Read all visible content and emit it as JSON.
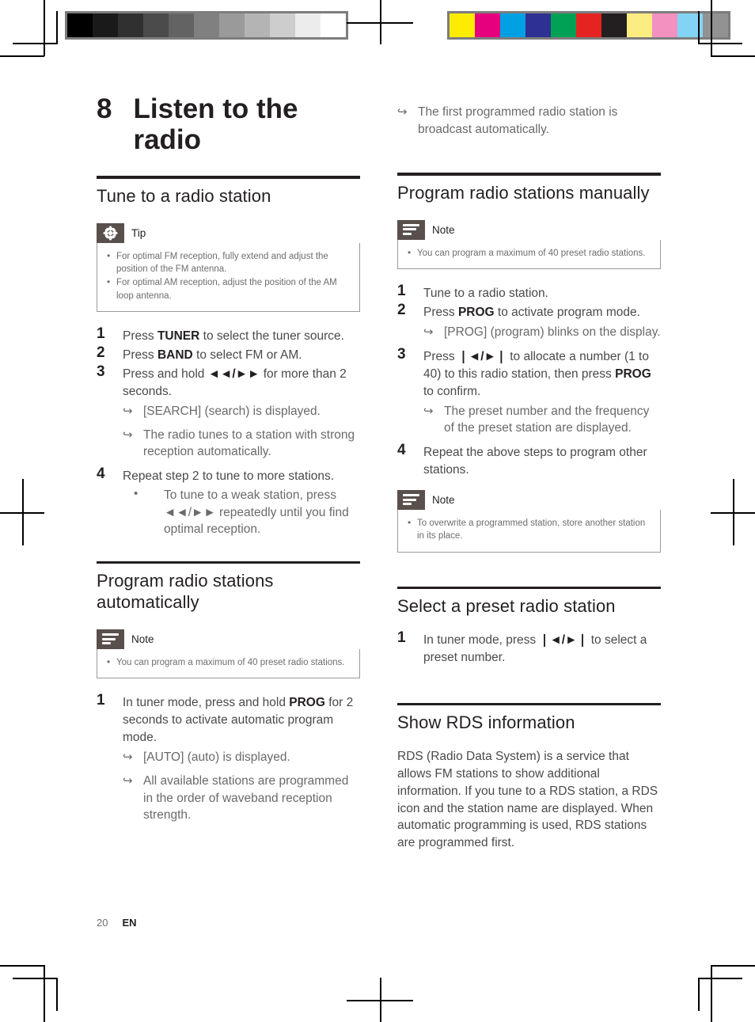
{
  "calibration": {
    "grayscale_label": "grayscale-calibration-strip",
    "grayscale": [
      "#000000",
      "#1a1a1a",
      "#303030",
      "#4b4b4b",
      "#636363",
      "#808080",
      "#9a9a9a",
      "#b4b4b4",
      "#cdcdcd",
      "#ececec",
      "#ffffff"
    ],
    "color_label": "color-calibration-strip",
    "colors": [
      "#fdec00",
      "#e6007e",
      "#00a0e3",
      "#2e3191",
      "#00a155",
      "#e52421",
      "#231f20",
      "#fced83",
      "#f391c0",
      "#83d4f4",
      "#929292"
    ]
  },
  "chapter": {
    "number": "8",
    "title": "Listen to the radio"
  },
  "footer": {
    "page_number": "20",
    "language": "EN"
  },
  "left_column": {
    "section1": {
      "heading": "Tune to a radio station",
      "tip": {
        "label": "Tip",
        "icon": "asterisk-icon",
        "items": [
          "For optimal FM reception, fully extend and adjust the position of the FM antenna.",
          "For optimal AM reception, adjust the position of the AM loop antenna."
        ]
      },
      "steps": [
        {
          "num": "1",
          "html": "Press <b>TUNER</b> to select the tuner source."
        },
        {
          "num": "2",
          "html": "Press <b>BAND</b> to select FM or AM."
        },
        {
          "num": "3",
          "html": "Press and hold <b>◄◄/►►</b> for more than 2 seconds."
        },
        {
          "num": "4",
          "html": "Repeat step 2 to tune to more stations."
        }
      ],
      "step3_results": [
        "[SEARCH] (search) is displayed.",
        "The radio tunes to a station with strong reception automatically."
      ],
      "step4_bullet": "To tune to a weak station, press <b>◄◄</b>/<b>►►</b> repeatedly until you find optimal reception."
    },
    "section2": {
      "heading": "Program radio stations automatically",
      "note": {
        "label": "Note",
        "icon": "note-lines-icon",
        "items": [
          "You can program a maximum of 40 preset radio stations."
        ]
      },
      "steps": [
        {
          "num": "1",
          "html": "In tuner mode, press and hold <b>PROG</b> for 2 seconds to activate automatic program mode."
        }
      ],
      "step1_results": [
        "[AUTO] (auto) is displayed.",
        "All available stations are programmed in the order of waveband reception strength."
      ]
    }
  },
  "right_column": {
    "continuation_result": "The first programmed radio station is broadcast automatically.",
    "section3": {
      "heading": "Program radio stations manually",
      "note": {
        "label": "Note",
        "icon": "note-lines-icon",
        "items": [
          "You can program a maximum of 40 preset radio stations."
        ]
      },
      "steps": [
        {
          "num": "1",
          "html": "Tune to a radio station."
        },
        {
          "num": "2",
          "html": "Press <b>PROG</b> to activate program mode."
        },
        {
          "num": "3",
          "html": "Press <b>❘◄/►❘</b> to allocate a number (1 to 40) to this radio station, then press <b>PROG</b> to confirm."
        },
        {
          "num": "4",
          "html": "Repeat the above steps to program other stations."
        }
      ],
      "step2_results": [
        "[PROG] (program) blinks on the display."
      ],
      "step3_results": [
        "The preset number and the frequency of the preset station are displayed."
      ],
      "note2": {
        "label": "Note",
        "icon": "note-lines-icon",
        "items": [
          "To overwrite a programmed station, store another station in its place."
        ]
      }
    },
    "section4": {
      "heading": "Select a preset radio station",
      "steps": [
        {
          "num": "1",
          "html": "In tuner mode, press <b>❘◄/►❘</b> to select a preset number."
        }
      ]
    },
    "section5": {
      "heading": "Show RDS information",
      "paragraph": "RDS (Radio Data System) is a service that allows FM stations to show additional information. If you tune to a RDS station, a RDS icon and the station name are displayed. When automatic programming is used, RDS stations are programmed first."
    }
  }
}
